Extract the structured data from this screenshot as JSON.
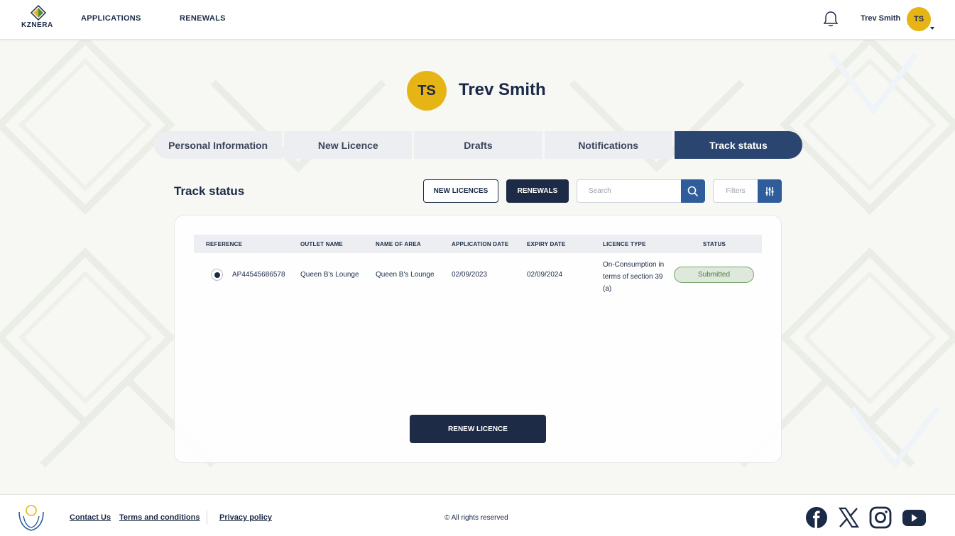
{
  "header": {
    "logo_text": "KZNERA",
    "nav": [
      "APPLICATIONS",
      "RENEWALS"
    ],
    "user_name": "Trev Smith",
    "user_initials": "TS"
  },
  "profile": {
    "initials": "TS",
    "name": "Trev Smith"
  },
  "tabs": [
    {
      "label": "Personal Information",
      "active": false
    },
    {
      "label": "New Licence",
      "active": false
    },
    {
      "label": "Drafts",
      "active": false
    },
    {
      "label": "Notifications",
      "active": false
    },
    {
      "label": "Track status",
      "active": true
    }
  ],
  "track": {
    "title": "Track status",
    "new_licences_label": "NEW LICENCES",
    "renewals_label": "RENEWALS",
    "search_placeholder": "Search",
    "filters_placeholder": "Filters"
  },
  "table": {
    "columns": [
      "REFERENCE",
      "OUTLET NAME",
      "NAME OF AREA",
      "APPLICATION DATE",
      "EXPIRY DATE",
      "LICENCE TYPE",
      "STATUS"
    ],
    "rows": [
      {
        "selected": true,
        "reference": "AP44545686578",
        "outlet_name": "Queen B's Lounge",
        "area": "Queen B's Lounge",
        "application_date": "02/09/2023",
        "expiry_date": "02/09/2024",
        "licence_type": "On-Consumption in terms of section 39 (a)",
        "status": "Submitted"
      }
    ]
  },
  "renew_label": "RENEW LICENCE",
  "footer": {
    "links": [
      "Contact Us",
      "Terms and conditions",
      "Privacy policy"
    ],
    "copyright": "© All rights reserved"
  },
  "colors": {
    "navy": "#1d2b47",
    "accent_blue": "#2f5d9c",
    "active_tab": "#2a4670",
    "avatar_yellow": "#e7b416",
    "status_green": "#7aa56d"
  }
}
